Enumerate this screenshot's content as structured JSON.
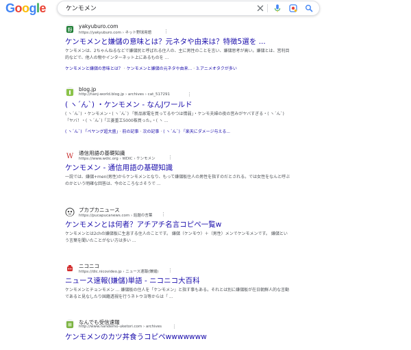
{
  "header": {
    "logo_letters": [
      {
        "ch": "G",
        "color": "#4285F4"
      },
      {
        "ch": "o",
        "color": "#EA4335"
      },
      {
        "ch": "o",
        "color": "#FBBC05"
      },
      {
        "ch": "g",
        "color": "#4285F4"
      },
      {
        "ch": "l",
        "color": "#34A853"
      },
      {
        "ch": "e",
        "color": "#EA4335"
      }
    ],
    "query": "ケンモメン"
  },
  "results": [
    {
      "site": "yakyuburo.com",
      "url": "https://yakyuburo.com › ネット野球用語",
      "title": "ケンモメンと嫌儲の意味とは？元ネタや由来は？特徴5選を ...",
      "snippet": "ケンモメンは、2ちゃんねるなどで嫌儲民と呼ばれる住人の、主に男性のことを言い、嫌儲思考が高い。嫌儲とは、営利目的などで、他人の物やインターネット上にあるものを ...",
      "links": [
        "ケンモメンと嫌儲の意味とは？",
        "ケンモメンと嫌儲の元ネタや由来...",
        "3.アニメオタクが多い"
      ],
      "favicon_color": "#1e7e34",
      "favicon_glyph": "野"
    },
    {
      "site": "blog.jp",
      "url": "http://nanj-world.blog.jp › archives › cat_517291",
      "title": "( ヽ´ん`) ・ケンモメン - なんJワールド",
      "snippet": "( ヽ´ん`) ・ケンモメン・( ヽ´ん`) 「新品家電を買ってるやつは情弱」・ケンモ夫婦の夜の営みがヤバすぎる・( ヽ´ん`) 「ヤバ！・( ヽ´ん`)「三菱重工5000株買った。・( ヽ ...",
      "links": [
        "( ヽ´ん`) 「ペヤング超大盛」",
        "前の記事",
        "次の記事",
        "( ヽ´ん`) 「楽天にダメージ与える..."
      ],
      "favicon_color": "#8bc34a",
      "favicon_glyph": "▮"
    },
    {
      "site": "通信用語の基礎知識",
      "url": "https://www.wdic.org › WDIC › ケンモメン",
      "title": "ケンモメン - 通信用語の基礎知識",
      "snippet": "一説では、嫌儲+men(男性)からケンモメンとなり、もって嫌儲板住人の男性を指すのだとされる。では女性をなんと呼ぶのかという明確な回答は、今のところなさそうで ...",
      "links": [],
      "favicon_color": "#c62828",
      "favicon_glyph": "W"
    },
    {
      "site": "プカプカニュース",
      "url": "https://pucapucanews.com › 話題の言葉",
      "title": "ケンモメンとは何者？アチアチ名言コピペ一覧w",
      "snippet": "ケンモメンとは2chの嫌儲板に生息する住人のことです。 嫌儲（ケンモウ）＋（男性）メンでケンモメンです。 嫌儲という言葉を聞いたことがない方は多い ...",
      "links": [],
      "favicon_color": "#424242",
      "favicon_glyph": "◕"
    },
    {
      "site": "ニコニコ",
      "url": "https://dic.nicovideo.jp › ニュース速報(嫌儲)",
      "title": "ニュース速報(嫌儲)単語 - ニコニコ大百科",
      "snippet": "ケンモメンとチョンモメン ... 嫌儲板の住人を「ケンモメン」と指す事もある。それとは別に嫌儲板が在日朝鮮人的な言動であると見なしたり国籍透視を行うネトウヨ等からは「 ...",
      "links": [],
      "favicon_color": "#d32f2f",
      "favicon_glyph": "◘"
    },
    {
      "site": "なんでも受信速報",
      "url": "http://www.nandemo-uketori.com › archives",
      "title": "ケンモメンのカツ丼食うコピペwwwwwww",
      "snippet": "",
      "links": [],
      "favicon_color": "#7cb342",
      "favicon_glyph": "▣"
    }
  ],
  "icons": [
    "clear-icon",
    "microphone-icon",
    "lens-icon",
    "search-icon",
    "more-options-icon"
  ]
}
